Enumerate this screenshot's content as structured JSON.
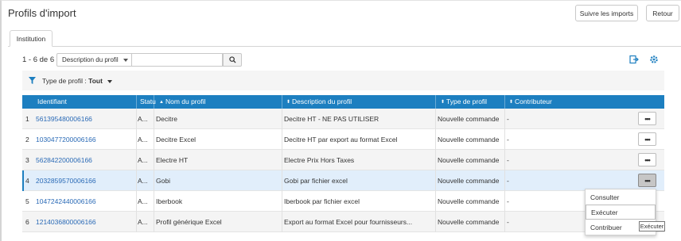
{
  "header": {
    "title": "Profils d'import",
    "follow_label": "Suivre les imports",
    "back_label": "Retour"
  },
  "tabs": [
    {
      "label": "Institution"
    }
  ],
  "toolbar": {
    "count": "1 - 6 de 6",
    "search_field": "Description du profil",
    "search_value": ""
  },
  "filter": {
    "label": "Type de profil :",
    "value": "Tout"
  },
  "table": {
    "headers": {
      "identifiant": "Identifiant",
      "statut": "Statu",
      "nom": "Nom du profil",
      "description": "Description du profil",
      "type": "Type de profil",
      "contributeur": "Contributeur"
    },
    "rows": [
      {
        "num": "1",
        "id": "561395480006166",
        "statut": "A...",
        "nom": "Decitre",
        "description": "Decitre HT - NE PAS UTILISER",
        "type": "Nouvelle commande",
        "contributeur": "-",
        "actions": "•••"
      },
      {
        "num": "2",
        "id": "1030477200006166",
        "statut": "A...",
        "nom": "Decitre Excel",
        "description": "Decitre HT par export au format Excel",
        "type": "Nouvelle commande",
        "contributeur": "-",
        "actions": "•••"
      },
      {
        "num": "3",
        "id": "562842200006166",
        "statut": "A...",
        "nom": "Electre HT",
        "description": "Electre Prix Hors Taxes",
        "type": "Nouvelle commande",
        "contributeur": "-",
        "actions": "•••"
      },
      {
        "num": "4",
        "id": "2032859570006166",
        "statut": "A...",
        "nom": "Gobi",
        "description": "Gobi par fichier excel",
        "type": "Nouvelle commande",
        "contributeur": "-",
        "actions": "•••"
      },
      {
        "num": "5",
        "id": "1047242440006166",
        "statut": "A...",
        "nom": "Iberbook",
        "description": "Iberbook par fichier excel",
        "type": "Nouvelle commande",
        "contributeur": "-",
        "actions": "•••"
      },
      {
        "num": "6",
        "id": "1214036800006166",
        "statut": "A...",
        "nom": "Profil générique Excel",
        "description": "Export au format Excel pour fournisseurs...",
        "type": "Nouvelle commande",
        "contributeur": "-",
        "actions": "•••"
      }
    ]
  },
  "context_menu": {
    "items": [
      {
        "label": "Consulter"
      },
      {
        "label": "Exécuter"
      },
      {
        "label": "Contribuer"
      }
    ]
  },
  "tooltip": {
    "text": "Exécuter"
  },
  "colors": {
    "accent": "#1d7fc0",
    "link": "#2a6ab6",
    "selected_row": "#e1eefb"
  },
  "icons": [
    "filter-icon",
    "search-icon",
    "export-icon",
    "settings-icon",
    "sort-asc-icon",
    "sort-both-icon",
    "caret-down-icon"
  ]
}
